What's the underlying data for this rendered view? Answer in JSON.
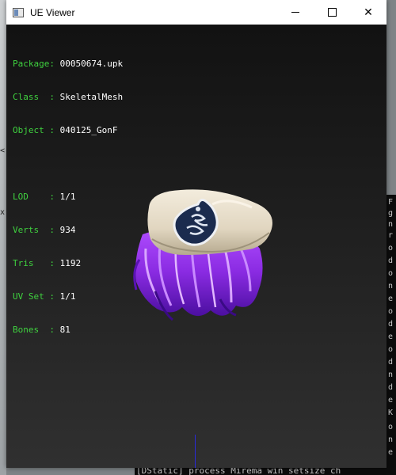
{
  "window": {
    "title": "UE Viewer",
    "controls": {
      "minimize": "minimize",
      "maximize": "maximize",
      "close": "✕"
    }
  },
  "info": {
    "group1": [
      {
        "key": "Package:",
        "value": "00050674.upk"
      },
      {
        "key": "Class  :",
        "value": "SkeletalMesh"
      },
      {
        "key": "Object :",
        "value": "040125_GonF"
      }
    ],
    "group2": [
      {
        "key": "LOD    :",
        "value": "1/1"
      },
      {
        "key": "Verts  :",
        "value": "934"
      },
      {
        "key": "Tris   :",
        "value": "1192"
      },
      {
        "key": "UV Set :",
        "value": "1/1"
      },
      {
        "key": "Bones  :",
        "value": "81"
      }
    ]
  },
  "colors": {
    "label_green": "#3fd13f",
    "value_white": "#ffffff",
    "hat_cream": "#e9dfcb",
    "hair_purple": "#8a2be2",
    "emblem_navy": "#1b2b4e"
  },
  "background": {
    "console_bottom_text": "[DStatic] process  Mirema win setsize  ch"
  }
}
